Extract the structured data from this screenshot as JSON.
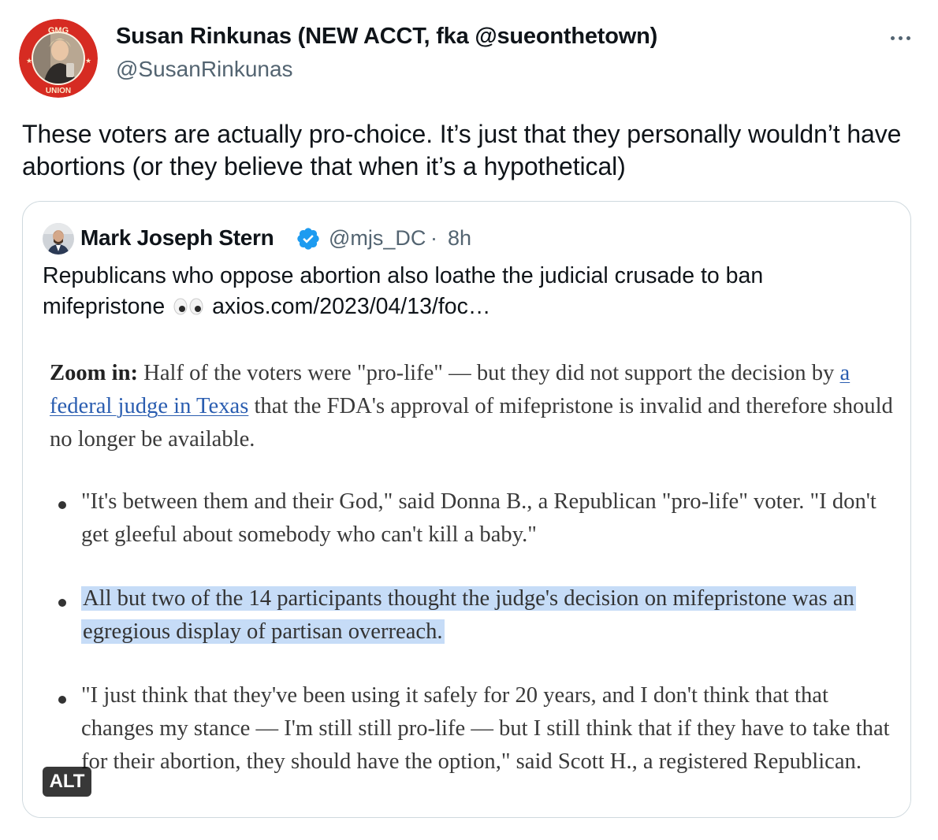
{
  "tweet": {
    "author_name": "Susan Rinkunas (NEW ACCT, fka @sueonthetown)",
    "author_handle": "@SusanRinkunas",
    "avatar_badge_top": "GMG",
    "avatar_badge_bottom": "UNION",
    "text": "These voters are actually pro-choice. It’s just that they personally wouldn’t have abortions (or they believe that when it’s a hypothetical)",
    "more_icon": "more-horizontal-icon"
  },
  "quote": {
    "author_name": "Mark Joseph Stern",
    "verified_icon": "verified-badge-icon",
    "author_handle": "@mjs_DC",
    "separator": "·",
    "time": "8h",
    "text_before_emoji": "Republicans who oppose abortion also loathe the judicial crusade to ban mifepristone",
    "emoji_icon": "eyes-emoji-icon",
    "link_text": "axios.com/2023/04/13/foc…"
  },
  "article": {
    "zoom_label": "Zoom in:",
    "para_part1": " Half of the voters were \"pro-life\" — but they did not support the decision by ",
    "para_link": "a federal judge in Texas",
    "para_part2": " that the FDA's approval of mifepristone is invalid and therefore should no longer be available.",
    "bullets": [
      "\"It's between them and their God,\" said Donna B., a Republican \"pro-life\" voter. \"I don't get gleeful about somebody who can't kill a baby.\"",
      "All but two of the 14 participants thought the judge's decision on mifepristone was an egregious display of partisan overreach.",
      "\"I just think that they've been using it safely for 20 years, and I don't think that that changes my stance — I'm still still pro-life — but I still think that if they have to take that for their abortion, they should have the option,\" said Scott H., a registered Republican."
    ],
    "highlight_color": "#c6dcf7",
    "link_color": "#2a5db0"
  },
  "alt_badge": "ALT"
}
